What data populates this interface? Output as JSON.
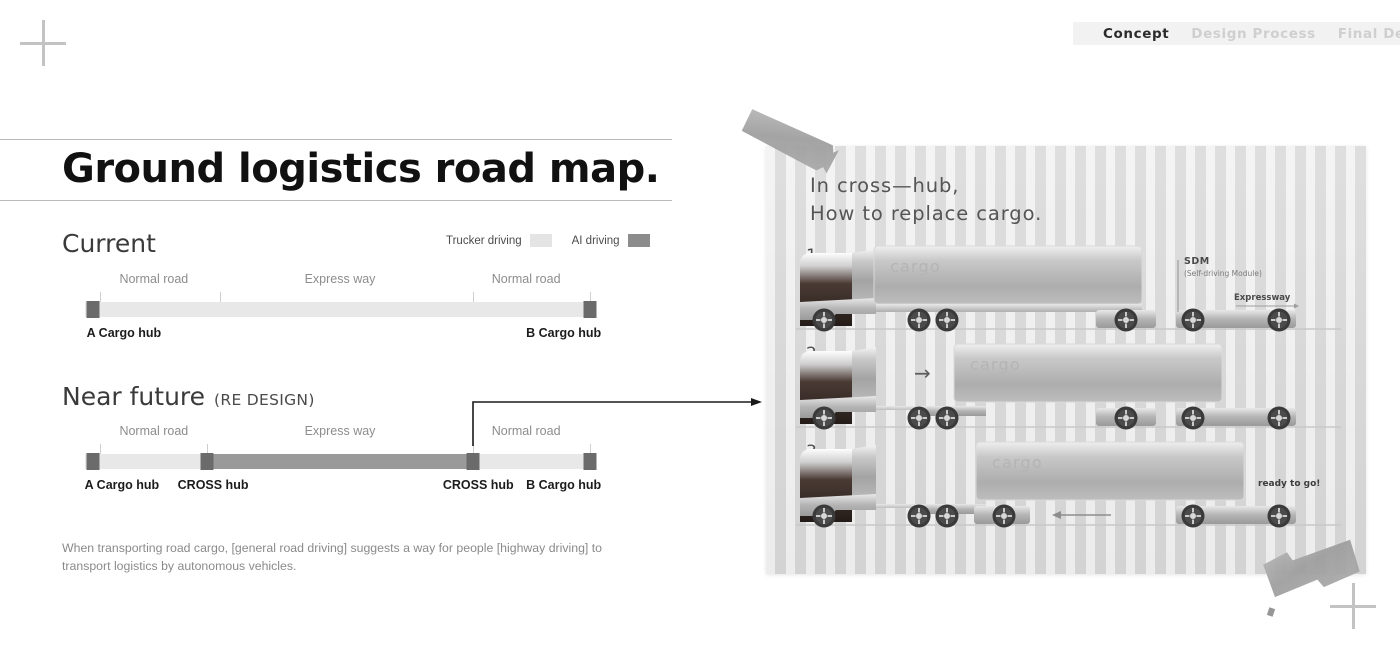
{
  "nav": {
    "tabs": [
      {
        "label": "Concept",
        "state": "active"
      },
      {
        "label": "Design Process",
        "state": "inactive"
      },
      {
        "label": "Final Design",
        "state": "inactive"
      }
    ]
  },
  "title": "Ground logistics road map.",
  "legend": {
    "items": [
      {
        "label": "Trucker driving",
        "color": "#e4e4e4"
      },
      {
        "label": "AI driving",
        "color": "#8c8c8c"
      }
    ]
  },
  "sections": {
    "current": {
      "heading": "Current",
      "sub": ""
    },
    "future": {
      "heading": "Near future",
      "sub": "(RE DESIGN)"
    }
  },
  "timeline_current": {
    "segments": [
      {
        "label": "Normal road",
        "center_pct": 13.5,
        "start_pct": 0,
        "end_pct": 26.5,
        "color": "#e8e8e8"
      },
      {
        "label": "Express way",
        "center_pct": 50,
        "start_pct": 26.5,
        "end_pct": 76,
        "color": "#e8e8e8"
      },
      {
        "label": "Normal road",
        "center_pct": 86.5,
        "start_pct": 76,
        "end_pct": 100,
        "color": "#e8e8e8"
      }
    ],
    "ticks_pct": [
      3,
      26.5,
      76,
      99
    ],
    "hubs": [
      {
        "label": "A Cargo hub",
        "pos_pct": 1.5
      },
      {
        "label": "B Cargo hub",
        "pos_pct": 99
      }
    ]
  },
  "timeline_future": {
    "segments": [
      {
        "label": "Normal road",
        "center_pct": 13.5,
        "start_pct": 0,
        "end_pct": 24,
        "color": "#e8e8e8"
      },
      {
        "label": "Express way",
        "center_pct": 50,
        "start_pct": 24,
        "end_pct": 76,
        "color": "#9a9a9a"
      },
      {
        "label": "Normal road",
        "center_pct": 86.5,
        "start_pct": 76,
        "end_pct": 100,
        "color": "#e8e8e8"
      }
    ],
    "ticks_pct": [
      3,
      24,
      76,
      99
    ],
    "hubs": [
      {
        "label": "A Cargo hub",
        "pos_pct": 1.5
      },
      {
        "label": "CROSS hub",
        "pos_pct": 24
      },
      {
        "label": "CROSS hub",
        "pos_pct": 76
      },
      {
        "label": "B Cargo hub",
        "pos_pct": 99
      }
    ]
  },
  "caption": "When transporting road cargo, [general road driving] suggests a way for people [highway driving] to transport logistics by autonomous vehicles.",
  "board": {
    "title": "In cross—hub,\nHow to replace cargo.",
    "steps": [
      {
        "number": "1.",
        "cargo_label": "cargo",
        "annotations": {
          "module_title": "SDM",
          "module_sub": "(Self-driving Module)",
          "lane_label": "Expressway"
        }
      },
      {
        "number": "2.",
        "cargo_label": "cargo",
        "arrow": "→"
      },
      {
        "number": "3.",
        "cargo_label": "cargo",
        "arrow": "←",
        "status_label": "ready to go!"
      }
    ]
  }
}
